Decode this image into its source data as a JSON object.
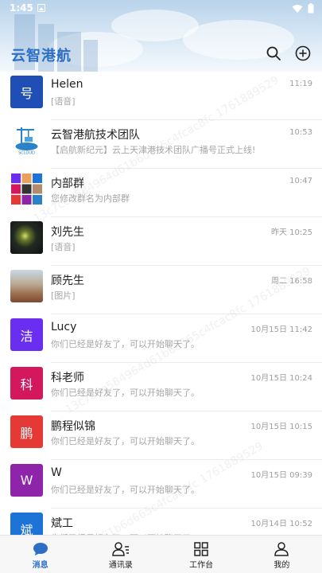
{
  "status_bar": {
    "time": "1:45"
  },
  "header": {
    "title": "云智港航"
  },
  "conversations": [
    {
      "name": "Helen",
      "preview": "[语音]",
      "time": "11:19",
      "avatar_text": "号",
      "avatar_color": "#1f4fb5"
    },
    {
      "name": "云智港航技术团队",
      "preview": "【启航新纪元】云上天津港技术团队广播号正式上线!",
      "time": "10:53",
      "avatar_text": "SCLOUD",
      "avatar_color": "#2a82c9"
    },
    {
      "name": "内部群",
      "preview": "您修改群名为内部群",
      "time": "10:47",
      "avatar_text": "",
      "avatar_color": "#ffffff"
    },
    {
      "name": "刘先生",
      "preview": "[语音]",
      "time": "昨天 10:25",
      "avatar_text": "",
      "avatar_color": "#2b2b2b"
    },
    {
      "name": "顾先生",
      "preview": "[图片]",
      "time": "周二 16:58",
      "avatar_text": "",
      "avatar_color": "#b48b6c"
    },
    {
      "name": "Lucy",
      "preview": "你们已经是好友了，可以开始聊天了。",
      "time": "10月15日 11:42",
      "avatar_text": "洁",
      "avatar_color": "#6a2ef0"
    },
    {
      "name": "科老师",
      "preview": "你们已经是好友了，可以开始聊天了。",
      "time": "10月15日 10:24",
      "avatar_text": "科",
      "avatar_color": "#d4185e"
    },
    {
      "name": "鹏程似锦",
      "preview": "你们已经是好友了，可以开始聊天了。",
      "time": "10月15日 10:15",
      "avatar_text": "鹏",
      "avatar_color": "#e53935"
    },
    {
      "name": "W",
      "preview": "你们已经是好友了，可以开始聊天了。",
      "time": "10月15日 09:39",
      "avatar_text": "W",
      "avatar_color": "#8e24aa"
    },
    {
      "name": "斌工",
      "preview": "你们已经是好友了，可以开始聊天了。",
      "time": "10月14日 10:52",
      "avatar_text": "斌",
      "avatar_color": "#1e73d6"
    }
  ],
  "watermark": "13c7cee584964d61b6d665c4fcac8fc 1761889529",
  "bottom_nav": [
    {
      "label": "消息",
      "icon": "chat-bubble-icon",
      "active": true
    },
    {
      "label": "通讯录",
      "icon": "contacts-icon",
      "active": false
    },
    {
      "label": "工作台",
      "icon": "grid-icon",
      "active": false
    },
    {
      "label": "我的",
      "icon": "person-icon",
      "active": false
    }
  ],
  "colors": {
    "accent": "#2d6fc4",
    "preview_text": "#a6a6a6"
  }
}
